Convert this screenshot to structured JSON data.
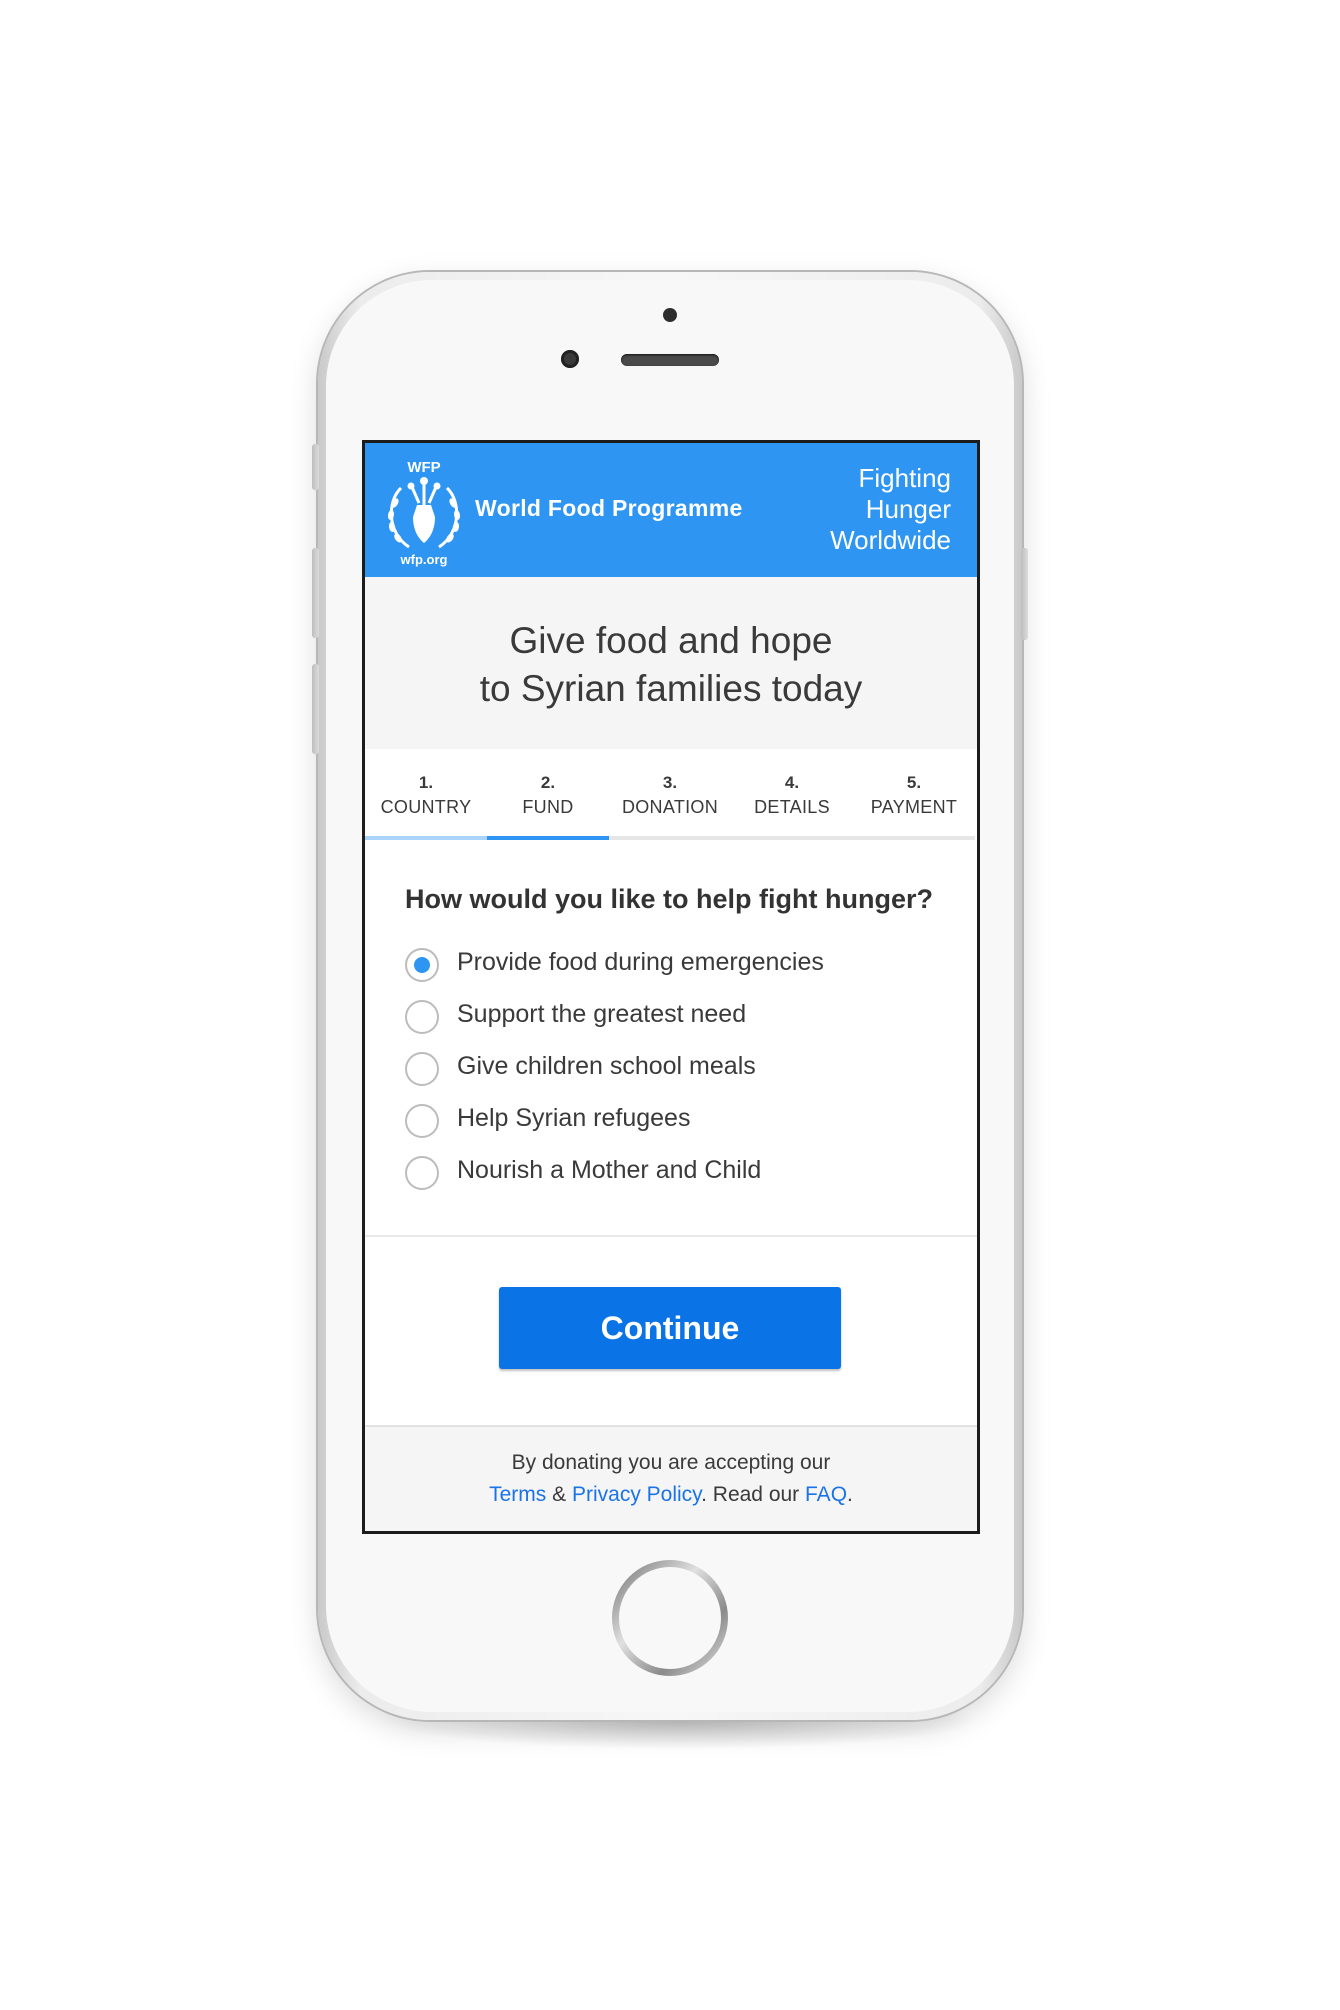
{
  "header": {
    "logo_top": "WFP",
    "logo_bottom": "wfp.org",
    "brand_name": "World Food Programme",
    "tagline": "Fighting\nHunger\nWorldwide"
  },
  "hero": {
    "title": "Give food and hope\nto Syrian families today"
  },
  "steps": [
    {
      "number": "1.",
      "label": "COUNTRY",
      "state": "completed"
    },
    {
      "number": "2.",
      "label": "FUND",
      "state": "active"
    },
    {
      "number": "3.",
      "label": "DONATION",
      "state": "upcoming"
    },
    {
      "number": "4.",
      "label": "DETAILS",
      "state": "upcoming"
    },
    {
      "number": "5.",
      "label": "PAYMENT",
      "state": "upcoming"
    }
  ],
  "question": "How would you like to help fight hunger?",
  "options": [
    {
      "label": "Provide food during emergencies",
      "selected": true
    },
    {
      "label": "Support the greatest need",
      "selected": false
    },
    {
      "label": "Give children school meals",
      "selected": false
    },
    {
      "label": "Help Syrian refugees",
      "selected": false
    },
    {
      "label": "Nourish a Mother and Child",
      "selected": false
    }
  ],
  "continue_label": "Continue",
  "footer": {
    "line1": "By donating you are accepting our",
    "terms": "Terms",
    "amp": " & ",
    "privacy": "Privacy Policy",
    "read_our": ". Read our ",
    "faq": "FAQ",
    "end": "."
  },
  "colors": {
    "brand_blue": "#2f95f3",
    "button_blue": "#0a73e5",
    "step_completed": "#a9d3fb",
    "step_active": "#2f95f3",
    "step_upcoming": "#e6e6e6",
    "link": "#1a73e8"
  },
  "icons": {
    "logo": "wfp-wreath-logo-icon"
  }
}
